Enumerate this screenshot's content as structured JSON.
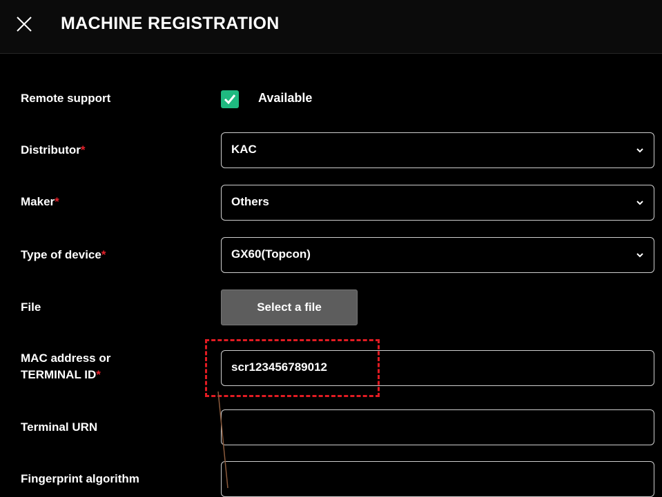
{
  "header": {
    "title": "MACHINE REGISTRATION",
    "close_icon": "close-icon"
  },
  "form": {
    "remote_support": {
      "label": "Remote support",
      "checked": true,
      "option_label": "Available"
    },
    "distributor": {
      "label": "Distributor",
      "required_mark": "*",
      "value": "KAC"
    },
    "maker": {
      "label": "Maker",
      "required_mark": "*",
      "value": "Others"
    },
    "type_of_device": {
      "label": "Type of device",
      "required_mark": "*",
      "value": "GX60(Topcon)"
    },
    "file": {
      "label": "File",
      "button_label": "Select a file"
    },
    "mac_address": {
      "label_line1": "MAC address or",
      "label_line2": "TERMINAL ID",
      "required_mark": "*",
      "value": "scr123456789012"
    },
    "terminal_urn": {
      "label": "Terminal URN",
      "value": ""
    },
    "fingerprint_algorithm": {
      "label": "Fingerprint algorithm",
      "value": ""
    }
  },
  "colors": {
    "accent_check": "#1fb980",
    "required": "#e5202a",
    "highlight": "#e11b22"
  }
}
